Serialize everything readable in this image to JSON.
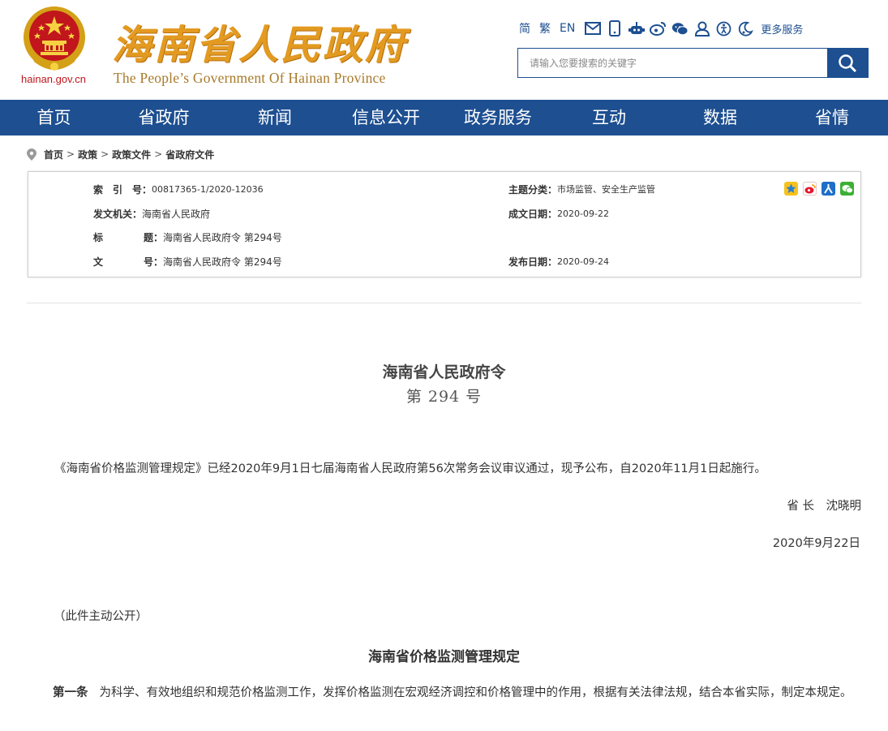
{
  "header": {
    "site_title": "海南省人民政府",
    "site_subtitle": "The People’s Government Of Hainan Province",
    "domain": "hainan.gov.cn",
    "toplinks": {
      "simplified": "简",
      "traditional": "繁",
      "english": "EN",
      "more": "更多服务"
    },
    "toplink_icons": [
      "mail-icon",
      "mobile-icon",
      "robot-icon",
      "weibo-icon",
      "wechat-icon",
      "user-icon",
      "accessibility-icon",
      "elderly-mode-icon"
    ],
    "search_placeholder": "请输入您要搜索的关键字"
  },
  "nav": {
    "items": [
      {
        "label": "首页"
      },
      {
        "label": "省政府"
      },
      {
        "label": "新闻"
      },
      {
        "label": "信息公开"
      },
      {
        "label": "政务服务"
      },
      {
        "label": "互动"
      },
      {
        "label": "数据"
      },
      {
        "label": "省情"
      }
    ]
  },
  "breadcrumb": {
    "items": [
      {
        "label": "首页"
      },
      {
        "label": "政策"
      },
      {
        "label": "政策文件"
      },
      {
        "label": "省政府文件"
      }
    ],
    "separator": ">"
  },
  "meta": {
    "index_label": "索　引　号：",
    "index_value": "00817365-1/2020-12036",
    "topic_label": "主题分类：",
    "topic_value": "市场监管、安全生产监管",
    "issuer_label": "发文机关：",
    "issuer_value": "海南省人民政府",
    "written_label": "成文日期：",
    "written_value": "2020-09-22",
    "title_label_1": "标",
    "title_label_2": "题：",
    "title_value": "海南省人民政府令 第294号",
    "docno_label_1": "文",
    "docno_label_2": "号：",
    "docno_value": "海南省人民政府令 第294号",
    "publish_label": "发布日期：",
    "publish_value": "2020-09-24",
    "share_icons": [
      "qzone-share-icon",
      "weibo-share-icon",
      "renren-share-icon",
      "wechat-share-icon"
    ]
  },
  "article": {
    "order_title": "海南省人民政府令",
    "order_number": "第 294 号",
    "paragraph1": "《海南省价格监测管理规定》已经2020年9月1日七届海南省人民政府第56次常务会议审议通过，现予公布，自2020年11月1日起施行。",
    "signer": "省 长　沈晓明",
    "sign_date": "2020年9月22日",
    "notice": "（此件主动公开）",
    "rule_title": "海南省价格监测管理规定",
    "article1_no": "第一条",
    "article1_text": "为科学、有效地组织和规范价格监测工作，发挥价格监测在宏观经济调控和价格管理中的作用，根据有关法律法规，结合本省实际，制定本规定。"
  },
  "colors": {
    "primary_blue": "#1d4f91",
    "title_gold": "#e39a21",
    "emblem_red": "#c1161c"
  }
}
